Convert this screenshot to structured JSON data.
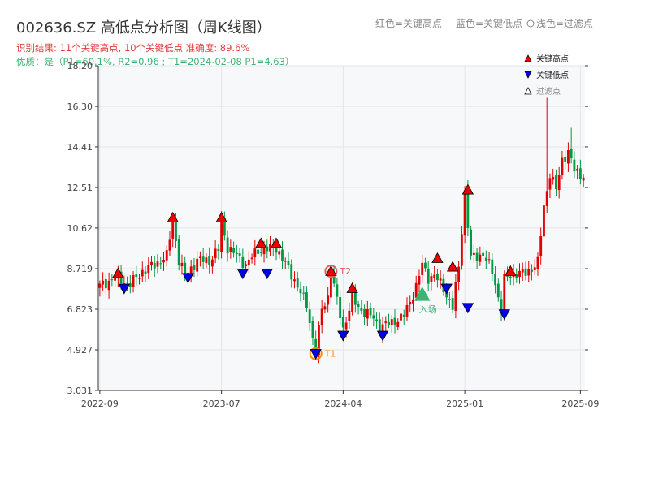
{
  "header": {
    "title": "002636.SZ 高低点分析图（周K线图）",
    "result_line": "识别结果: 11个关键高点, 10个关键低点  准确度: 89.6%",
    "quality_line": "优质：是（P1=60.1%, R2=0.96 ; T1=2024-02-08 P1=4.63）",
    "legend_red": "红色=关键高点",
    "legend_blue": "蓝色=关键低点",
    "legend_light": "浅色=过滤点"
  },
  "colors": {
    "up": "#e00000",
    "down": "#009944",
    "high_marker": "#ee0000",
    "low_marker": "#0000ee",
    "t_marker": "#ff8c00",
    "entry_marker": "#3cb371",
    "result_text": "#e04040",
    "quality_text": "#3cb371",
    "plot_bg": "#f6f8fa"
  },
  "chart_data": {
    "type": "candlestick",
    "ylim": [
      3.031,
      18.2
    ],
    "ytick_labels": [
      "3.031",
      "4.927",
      "6.823",
      "8.719",
      "10.62",
      "12.51",
      "14.41",
      "16.30",
      "18.20"
    ],
    "ytick_values": [
      3.031,
      4.927,
      6.823,
      8.719,
      10.62,
      12.51,
      14.41,
      16.3,
      18.2
    ],
    "xtick_labels": [
      "2022-09",
      "2023-07",
      "2024-04",
      "2025-01",
      "2025-09"
    ],
    "xtick_weeks": [
      0,
      40,
      80,
      120,
      158
    ],
    "week_count": 160,
    "anchor_prices": [
      [
        0,
        7.9
      ],
      [
        5,
        8.3
      ],
      [
        10,
        8.0
      ],
      [
        14,
        8.6
      ],
      [
        18,
        8.9
      ],
      [
        22,
        9.3
      ],
      [
        24,
        11.0
      ],
      [
        26,
        9.1
      ],
      [
        28,
        8.4
      ],
      [
        32,
        9.1
      ],
      [
        36,
        9.1
      ],
      [
        39,
        9.6
      ],
      [
        40,
        10.9
      ],
      [
        42,
        9.7
      ],
      [
        46,
        9.2
      ],
      [
        48,
        8.9
      ],
      [
        52,
        9.6
      ],
      [
        54,
        9.6
      ],
      [
        58,
        9.7
      ],
      [
        60,
        9.2
      ],
      [
        64,
        8.2
      ],
      [
        68,
        7.0
      ],
      [
        70,
        5.5
      ],
      [
        71,
        4.8
      ],
      [
        73,
        6.8
      ],
      [
        75,
        7.4
      ],
      [
        76,
        8.6
      ],
      [
        78,
        7.2
      ],
      [
        80,
        5.9
      ],
      [
        83,
        7.3
      ],
      [
        85,
        6.9
      ],
      [
        90,
        6.4
      ],
      [
        92,
        6.0
      ],
      [
        96,
        6.2
      ],
      [
        100,
        6.5
      ],
      [
        104,
        7.9
      ],
      [
        106,
        8.9
      ],
      [
        108,
        8.3
      ],
      [
        110,
        8.4
      ],
      [
        113,
        7.8
      ],
      [
        116,
        6.9
      ],
      [
        118,
        8.8
      ],
      [
        120,
        12.3
      ],
      [
        122,
        9.2
      ],
      [
        126,
        9.4
      ],
      [
        129,
        8.6
      ],
      [
        132,
        6.8
      ],
      [
        133,
        8.2
      ],
      [
        136,
        8.5
      ],
      [
        140,
        8.5
      ],
      [
        144,
        9.0
      ],
      [
        146,
        11.6
      ],
      [
        148,
        13.2
      ],
      [
        150,
        12.4
      ],
      [
        152,
        13.8
      ],
      [
        154,
        14.2
      ],
      [
        156,
        13.3
      ],
      [
        158,
        13.1
      ],
      [
        159,
        13.1
      ]
    ],
    "spikes": [
      [
        147,
        16.7
      ],
      [
        155,
        15.3
      ]
    ],
    "key_highs": [
      {
        "week": 6,
        "price": 8.5
      },
      {
        "week": 24,
        "price": 11.1
      },
      {
        "week": 40,
        "price": 11.1
      },
      {
        "week": 53,
        "price": 9.9
      },
      {
        "week": 58,
        "price": 9.9
      },
      {
        "week": 83,
        "price": 7.8
      },
      {
        "week": 111,
        "price": 9.2
      },
      {
        "week": 116,
        "price": 8.8
      },
      {
        "week": 121,
        "price": 12.4
      },
      {
        "week": 135,
        "price": 8.6
      }
    ],
    "key_lows": [
      {
        "week": 8,
        "price": 7.8
      },
      {
        "week": 29,
        "price": 8.3
      },
      {
        "week": 47,
        "price": 8.5
      },
      {
        "week": 55,
        "price": 8.5
      },
      {
        "week": 80,
        "price": 5.6
      },
      {
        "week": 93,
        "price": 5.6
      },
      {
        "week": 114,
        "price": 7.8
      },
      {
        "week": 121,
        "price": 6.9
      },
      {
        "week": 133,
        "price": 6.6
      }
    ],
    "t_points": [
      {
        "label": "T1",
        "week": 71,
        "price": 4.75
      },
      {
        "label": "T2",
        "week": 76,
        "price": 8.6
      }
    ],
    "entry_point": {
      "label": "入场",
      "week": 106,
      "price": 7.5
    },
    "legend": [
      {
        "label": "关键高点",
        "marker": "triangle-up"
      },
      {
        "label": "关键低点",
        "marker": "triangle-down"
      },
      {
        "label": "过滤点",
        "marker": "triangle-up-hollow"
      }
    ]
  }
}
